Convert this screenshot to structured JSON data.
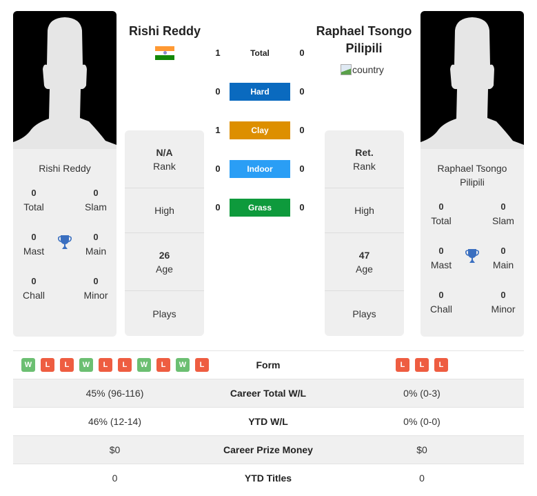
{
  "players": {
    "left": {
      "name": "Rishi Reddy",
      "country_flag": "india-flag",
      "card_name": "Rishi Reddy",
      "titles": {
        "total": {
          "value": "0",
          "label": "Total"
        },
        "slam": {
          "value": "0",
          "label": "Slam"
        },
        "mast": {
          "value": "0",
          "label": "Mast"
        },
        "main": {
          "value": "0",
          "label": "Main"
        },
        "chall": {
          "value": "0",
          "label": "Chall"
        },
        "minor": {
          "value": "0",
          "label": "Minor"
        }
      },
      "rank": {
        "value": "N/A",
        "label": "Rank"
      },
      "high": {
        "value": "",
        "label": "High"
      },
      "age": {
        "value": "26",
        "label": "Age"
      },
      "plays": {
        "value": "",
        "label": "Plays"
      }
    },
    "right": {
      "name": "Raphael Tsongo Pilipili",
      "country_alt": "country",
      "card_name": "Raphael Tsongo Pilipili",
      "titles": {
        "total": {
          "value": "0",
          "label": "Total"
        },
        "slam": {
          "value": "0",
          "label": "Slam"
        },
        "mast": {
          "value": "0",
          "label": "Mast"
        },
        "main": {
          "value": "0",
          "label": "Main"
        },
        "chall": {
          "value": "0",
          "label": "Chall"
        },
        "minor": {
          "value": "0",
          "label": "Minor"
        }
      },
      "rank": {
        "value": "Ret.",
        "label": "Rank"
      },
      "high": {
        "value": "",
        "label": "High"
      },
      "age": {
        "value": "47",
        "label": "Age"
      },
      "plays": {
        "value": "",
        "label": "Plays"
      }
    }
  },
  "h2h": [
    {
      "label": "Total",
      "left": "1",
      "right": "0",
      "color": ""
    },
    {
      "label": "Hard",
      "left": "0",
      "right": "0",
      "color": "#0a6abf"
    },
    {
      "label": "Clay",
      "left": "1",
      "right": "0",
      "color": "#dd8f00"
    },
    {
      "label": "Indoor",
      "left": "0",
      "right": "0",
      "color": "#2a9ef5"
    },
    {
      "label": "Grass",
      "left": "0",
      "right": "0",
      "color": "#0e9a3c"
    }
  ],
  "stats": {
    "form_label": "Form",
    "form_left": [
      "W",
      "L",
      "L",
      "W",
      "L",
      "L",
      "W",
      "L",
      "W",
      "L"
    ],
    "form_right": [
      "L",
      "L",
      "L"
    ],
    "rows": [
      {
        "label": "Career Total W/L",
        "left": "45% (96-116)",
        "right": "0% (0-3)"
      },
      {
        "label": "YTD W/L",
        "left": "46% (12-14)",
        "right": "0% (0-0)"
      },
      {
        "label": "Career Prize Money",
        "left": "$0",
        "right": "$0"
      },
      {
        "label": "YTD Titles",
        "left": "0",
        "right": "0"
      }
    ]
  },
  "colors": {
    "win": "#6cbf72",
    "loss": "#ee5d41",
    "trophy": "#3a6fc0"
  }
}
